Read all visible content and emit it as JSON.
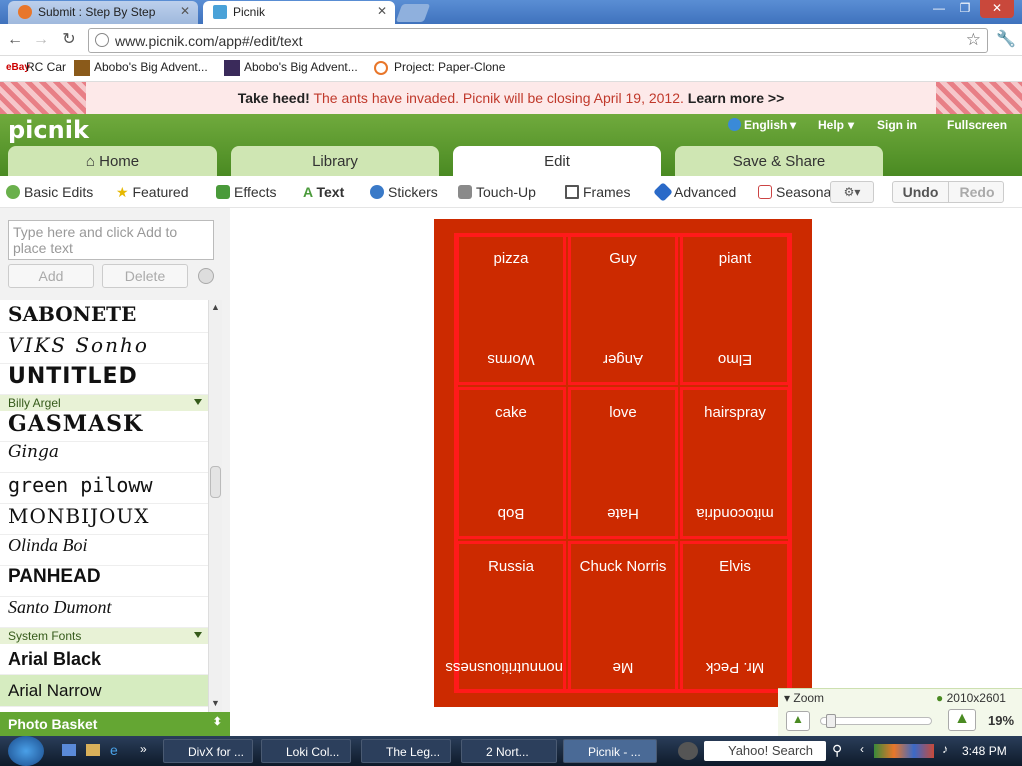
{
  "browser": {
    "tabs": [
      {
        "label": "Submit : Step By Step",
        "favicon_color": "#e8762a"
      },
      {
        "label": "Picnik",
        "favicon_color": "#4aa2d8"
      }
    ],
    "url": "www.picnik.com/app#/edit/text",
    "bookmarks": [
      "RC Car",
      "Abobo's Big Advent...",
      "Abobo's Big Advent...",
      "Project: Paper-Clone"
    ]
  },
  "banner": {
    "lead": "Take heed!",
    "message": "The ants have invaded. Picnik will be closing April 19, 2012.",
    "link": "Learn more >>"
  },
  "header": {
    "logo": "picnik",
    "menu": [
      "English",
      "Help",
      "Sign in",
      "Fullscreen"
    ],
    "tabs": [
      "Home",
      "Library",
      "Edit",
      "Save & Share"
    ],
    "active_tab": "Edit"
  },
  "toolbar": {
    "items": [
      "Basic Edits",
      "Featured",
      "Effects",
      "Text",
      "Stickers",
      "Touch-Up",
      "Frames",
      "Advanced",
      "Seasona"
    ],
    "active": "Text",
    "undo": "Undo",
    "redo": "Redo"
  },
  "left_panel": {
    "placeholder": "Type here and click Add to place text",
    "add": "Add",
    "delete": "Delete",
    "fonts_top": [
      "SABONETE",
      "VIKS Sonho",
      "UNTITLED"
    ],
    "group1": "Billy Argel",
    "fonts_g1": [
      "GASMASK",
      "Ginga",
      "green piloww",
      "MONBIJOUX",
      "Olinda Boi",
      "PANHEAD",
      "Santo Dumont"
    ],
    "group2": "System Fonts",
    "fonts_g2": [
      "Arial Black",
      "Arial Narrow"
    ],
    "photo_basket": "Photo Basket"
  },
  "canvas_cells": [
    {
      "top": "pizza",
      "bottom": "Worms"
    },
    {
      "top": "Guy",
      "bottom": "Anger"
    },
    {
      "top": "piant",
      "bottom": "Elmo"
    },
    {
      "top": "cake",
      "bottom": "Bob"
    },
    {
      "top": "love",
      "bottom": "Hate"
    },
    {
      "top": "hairspray",
      "bottom": "mitocondria"
    },
    {
      "top": "Russia",
      "bottom": "nonnutritiousness"
    },
    {
      "top": "Chuck Norris",
      "bottom": "Me"
    },
    {
      "top": "Elvis",
      "bottom": "Mr. Peck"
    }
  ],
  "zoom": {
    "label": "Zoom",
    "dimensions": "2010x2601",
    "percent": "19%",
    "level": 0.05
  },
  "taskbar": {
    "items": [
      "DivX for ...",
      "Loki Col...",
      "The Leg...",
      "2 Nort...",
      "Picnik - ..."
    ],
    "search": "Yahoo! Search",
    "time": "3:48 PM"
  }
}
